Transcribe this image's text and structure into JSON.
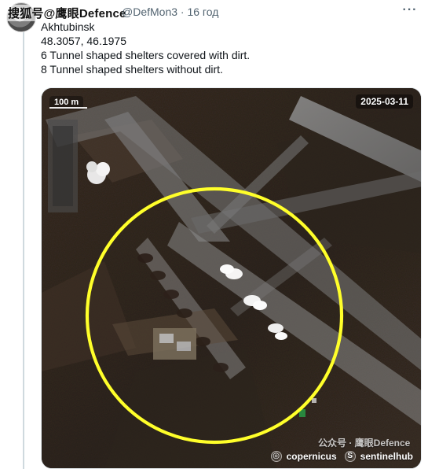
{
  "header": {
    "watermark_text": "搜狐号@鹰眼Defence",
    "meta_text": "@DefMon3 · 16 год",
    "more_glyph": "···"
  },
  "post": {
    "lines": [
      "Akhtubinsk",
      "48.3057, 46.1975",
      "6  Tunnel shaped shelters covered with dirt.",
      "8 Tunnel shaped shelters without dirt."
    ]
  },
  "image": {
    "date_badge": "2025-03-11",
    "scale_label": "100 m",
    "watermark_cn": "公众号 · 鹰眼Defence",
    "logos": {
      "copernicus": "copernicus",
      "sentinelhub": "sentinelhub"
    },
    "highlight_color": "#ffff2a"
  },
  "icons": {
    "more": "more-icon",
    "avatar": "avatar-image"
  }
}
